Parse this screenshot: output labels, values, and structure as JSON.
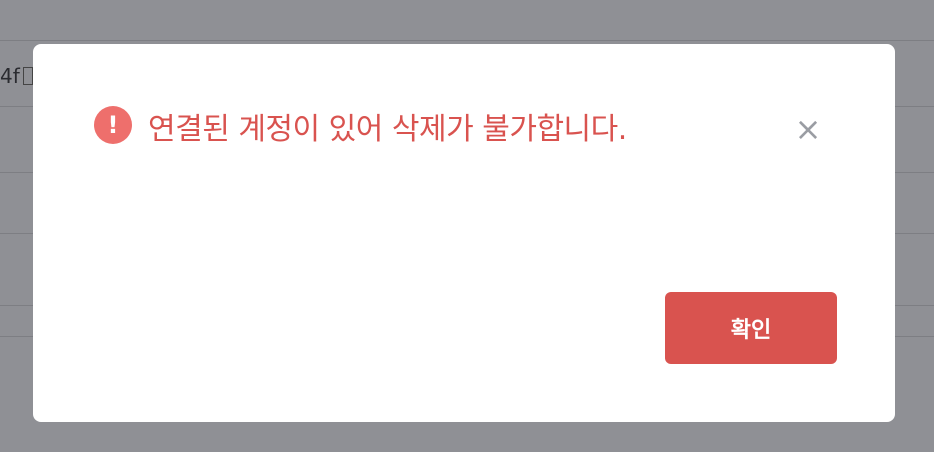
{
  "background": {
    "partial_text": "4f"
  },
  "dialog": {
    "message": "연결된 계정이 있어 삭제가 불가합니다.",
    "alert_icon": "!",
    "close_icon": "×",
    "confirm_label": "확인"
  },
  "colors": {
    "accent": "#d9534f",
    "icon": "#ee6f6c",
    "overlay": "#8f9095"
  }
}
